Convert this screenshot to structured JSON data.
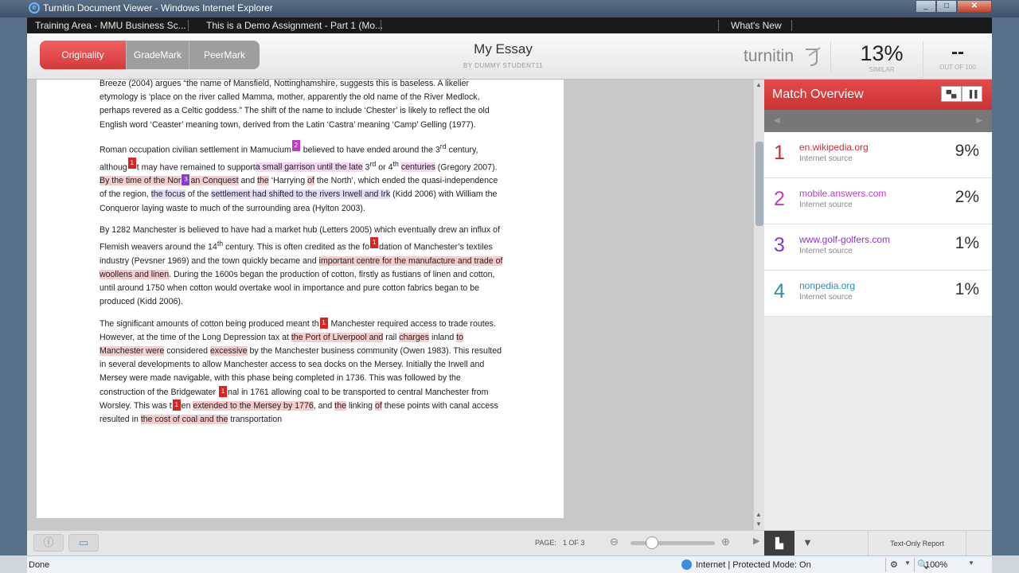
{
  "window": {
    "title": "Turnitin Document Viewer - Windows Internet Explorer",
    "controls": [
      "_",
      "□",
      "✕"
    ]
  },
  "tabs": {
    "left1": "Training Area - MMU Business Sc...",
    "left2": "This is a Demo Assignment - Part 1 (Mo...",
    "right": "What's New"
  },
  "modes": {
    "originality": "Originality",
    "grademark": "GradeMark",
    "peermark": "PeerMark"
  },
  "essay": {
    "title": "My Essay",
    "byline": "BY DUMMY STUDENT11"
  },
  "brand": "turnitin",
  "similarity": {
    "value": "13%",
    "label": "SIMILAR"
  },
  "score": {
    "value": "--",
    "label": "OUT OF 100"
  },
  "doc": {
    "p1": "Breeze (2004) argues “the name of Mansfield, Nottinghamshire, suggests this is baseless. A likelier etymology is ‘place on the river called Mamma, mother, apparently the old name of the River Medlock, perhaps revered as a Celtic goddess.” The shift of the name to include ‘Chester’ is likely to reflect the old English word ‘Ceaster’ meaning town, derived from the Latin ‘Castra’ meaning ‘Camp’ Gelling (1977).",
    "p2": {
      "a": "Roman occupation civilian settlement in Mamucium",
      "b": " believed to have ended around the 3",
      "sup1": "rd",
      "c": " century, althoug",
      "d": "t may have remained to support",
      "e": "a small garrison until the late",
      "f": " 3",
      "sup2": "rd",
      "g": " or 4",
      "sup3": "th",
      "h": "centuries",
      "i": " (Gregory 2007).",
      "j": "By the time of the Nor",
      "k": "an Conquest",
      "l": " and ",
      "m": "the",
      "n": " ‘Harrying ",
      "o": "of",
      "p": " the North’, which ended the quasi-independence of the region, ",
      "q": "the focus",
      "r": " of the ",
      "s": "settlement had shifted to the rivers Irwell and Irk",
      "t": " (Kidd 2006) with William the Conqueror laying waste to much of the surrounding area (Hylton 2003)."
    },
    "p3": {
      "a": "By 1282 Manchester is believed to have had a market hub (Letters 2005) which eventually drew an influx of Flemish weavers around the 14",
      "sup": "th",
      "b": " century. This is often credited as the fo",
      "c": "dation of Manchester’s textiles industry (Pevsner  1969) and the town quickly became and ",
      "d": "important centre for the manufacture and trade of woollens and linen",
      "e": ". During the 1600s began the production of cotton, firstly as fustians of linen and cotton, until around 1750 when cotton would overtake wool in importance and pure cotton fabrics began to be produced (Kidd 2006)."
    },
    "p4": {
      "a": "The significant amounts of cotton being produced meant th",
      "b": " Manchester required access to trade routes. However, at the time of the Long Depression tax at ",
      "c": "the Port of Liverpool and",
      "d": " rail ",
      "e": "charges",
      "f": " inland ",
      "g": "to Manchester were",
      "h": " considered ",
      "i": "excessive",
      "j": " by the Manchester business community (Owen 1983). This resulted in several developments to allow Manchester access to sea docks on the Mersey. Initially the Irwell and Mersey were made navigable, with this phase being completed in 1736. This was followed by the construction of the Bridgewater ",
      "k": "nal in 1761 allowing coal to be transported to central Manchester from Worsley. This was t",
      "l": "en ",
      "m": "extended to the Mersey by 1776",
      "n": ", and ",
      "o": "the",
      "p": " linking ",
      "q": "of",
      "r": " these points with canal access resulted in ",
      "s": "the cost of coal and the",
      "t": " transportation"
    },
    "markers": {
      "one": "1",
      "two": "2",
      "three": "3"
    }
  },
  "match": {
    "title": "Match Overview",
    "items": [
      {
        "num": "1",
        "site": "en.wikipedia.org",
        "type": "Internet source",
        "pct": "9%",
        "color": "#d42a2a"
      },
      {
        "num": "2",
        "site": "mobile.answers.com",
        "type": "Internet source",
        "pct": "2%",
        "color": "#c63bc6"
      },
      {
        "num": "3",
        "site": "www.golf-golfers.com",
        "type": "Internet source",
        "pct": "1%",
        "color": "#8b35d1"
      },
      {
        "num": "4",
        "site": "nonpedia.org",
        "type": "Internet source",
        "pct": "1%",
        "color": "#2a8fb0"
      }
    ]
  },
  "footer": {
    "page_label": "PAGE:",
    "page_value": "1 OF 3",
    "text_only": "Text-Only Report"
  },
  "zoom_level": 0.25,
  "status": {
    "left": "Done",
    "middle": "Internet | Protected Mode: On",
    "zoom": "100%"
  }
}
